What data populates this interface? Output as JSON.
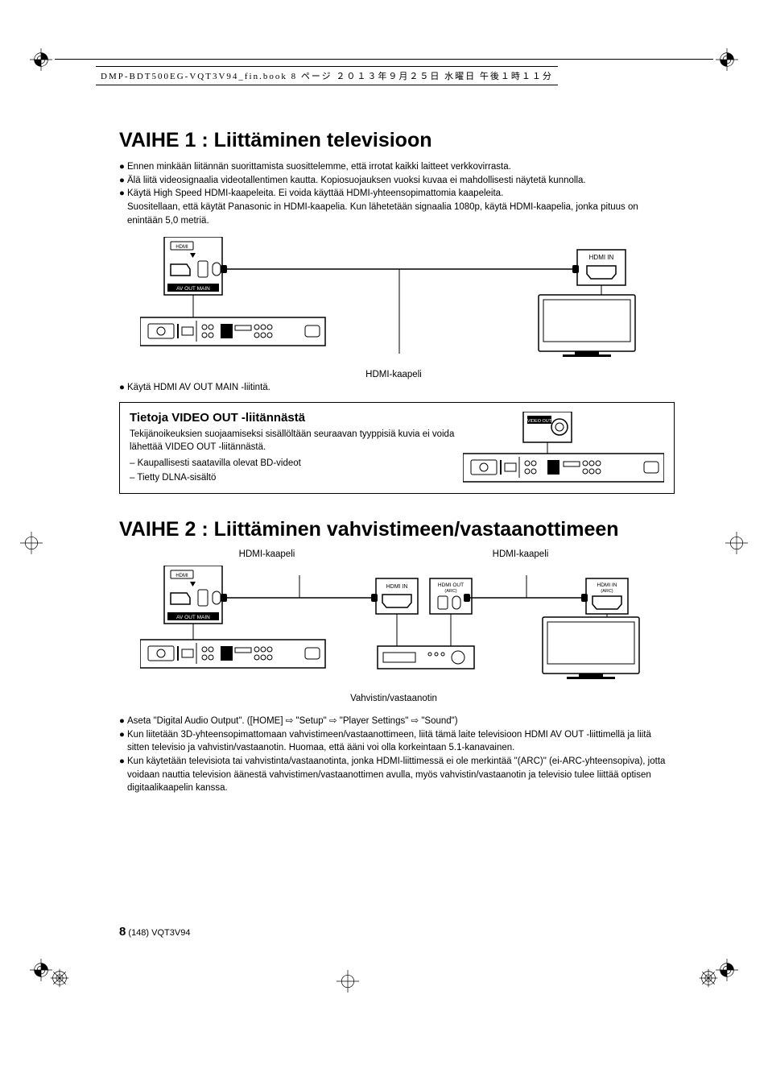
{
  "header": "DMP-BDT500EG-VQT3V94_fin.book  8 ページ  ２０１３年９月２５日  水曜日  午後１時１１分",
  "s1": {
    "title": "VAIHE 1 : Liittäminen televisioon",
    "b1": "Ennen minkään liitännän suorittamista suosittelemme, että irrotat kaikki laitteet verkkovirrasta.",
    "b2": "Älä liitä videosignaalia videotallentimen kautta. Kopiosuojauksen vuoksi kuvaa ei mahdollisesti näytetä kunnolla.",
    "b3": "Käytä High Speed HDMI-kaapeleita. Ei voida käyttää HDMI-yhteensopimattomia kaapeleita.",
    "b3_sub": "Suositellaan, että käytät Panasonic in HDMI-kaapelia. Kun lähetetään signaalia 1080p, käytä HDMI-kaapelia, jonka pituus on enintään 5,0 metriä.",
    "diag_hdmi_cable": "HDMI-kaapeli",
    "diag_hdmi_in": "HDMI IN",
    "diag_hdmi_logo": "HDMI",
    "diag_avout": "AV OUT   MAIN",
    "note": "Käytä HDMI AV OUT MAIN -liitintä."
  },
  "info": {
    "title": "Tietoja VIDEO OUT -liitännästä",
    "p1": "Tekijänoikeuksien suojaamiseksi sisällöltään seuraavan tyyppisiä kuvia ei voida lähettää VIDEO OUT -liitännästä.",
    "d1": "Kaupallisesti saatavilla olevat BD-videot",
    "d2": "Tietty DLNA-sisältö",
    "video_out": "VIDEO OUT"
  },
  "s2": {
    "title": "VAIHE 2 : Liittäminen vahvistimeen/vastaanottimeen",
    "hdmi_cable_l": "HDMI-kaapeli",
    "hdmi_cable_r": "HDMI-kaapeli",
    "hdmi_in": "HDMI IN",
    "hdmi_out_arc": "HDMI OUT",
    "arc1": "(ARC)",
    "hdmi_in_arc": "HDMI IN",
    "arc2": "(ARC)",
    "amp": "Vahvistin/vastaanotin",
    "b1": "Aseta \"Digital Audio Output\". ([HOME] ⇨ \"Setup\" ⇨ \"Player Settings\" ⇨ \"Sound\")",
    "b2": "Kun liitetään 3D-yhteensopimattomaan vahvistimeen/vastaanottimeen, liitä tämä laite televisioon HDMI AV OUT -liittimellä ja liitä sitten televisio ja vahvistin/vastaanotin. Huomaa, että ääni voi olla korkeintaan 5.1-kanavainen.",
    "b3": "Kun käytetään televisiota tai vahvistinta/vastaanotinta, jonka HDMI-liittimessä ei ole merkintää \"(ARC)\" (ei-ARC-yhteensopiva), jotta voidaan nauttia television äänestä vahvistimen/vastaanottimen avulla, myös vahvistin/vastaanotin ja televisio tulee liittää optisen digitaalikaapelin kanssa."
  },
  "footer": {
    "pg": "8",
    "ref": "(148) VQT3V94"
  }
}
